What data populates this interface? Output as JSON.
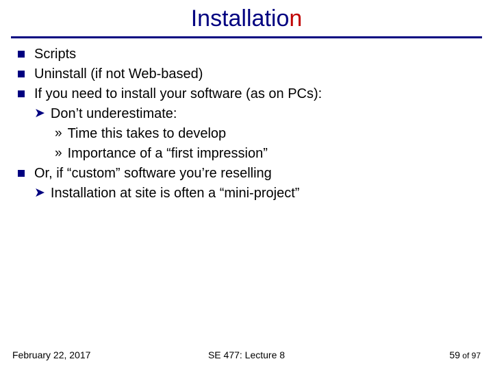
{
  "title_prefix": "Installatio",
  "title_hot": "n",
  "bullets": {
    "b1": "Scripts",
    "b2": "Uninstall (if not Web-based)",
    "b3": "If you need to install your software (as on PCs):",
    "b3_a": "Don’t underestimate:",
    "b3_a_i": "Time this takes to develop",
    "b3_a_ii": "Importance of a “first impression”",
    "b4": "Or, if “custom” software you’re reselling",
    "b4_a": "Installation at site is often a “mini-project”"
  },
  "footer": {
    "date": "February 22, 2017",
    "course": "SE 477: Lecture 8",
    "page": "59",
    "of": " of ",
    "total": "97"
  }
}
